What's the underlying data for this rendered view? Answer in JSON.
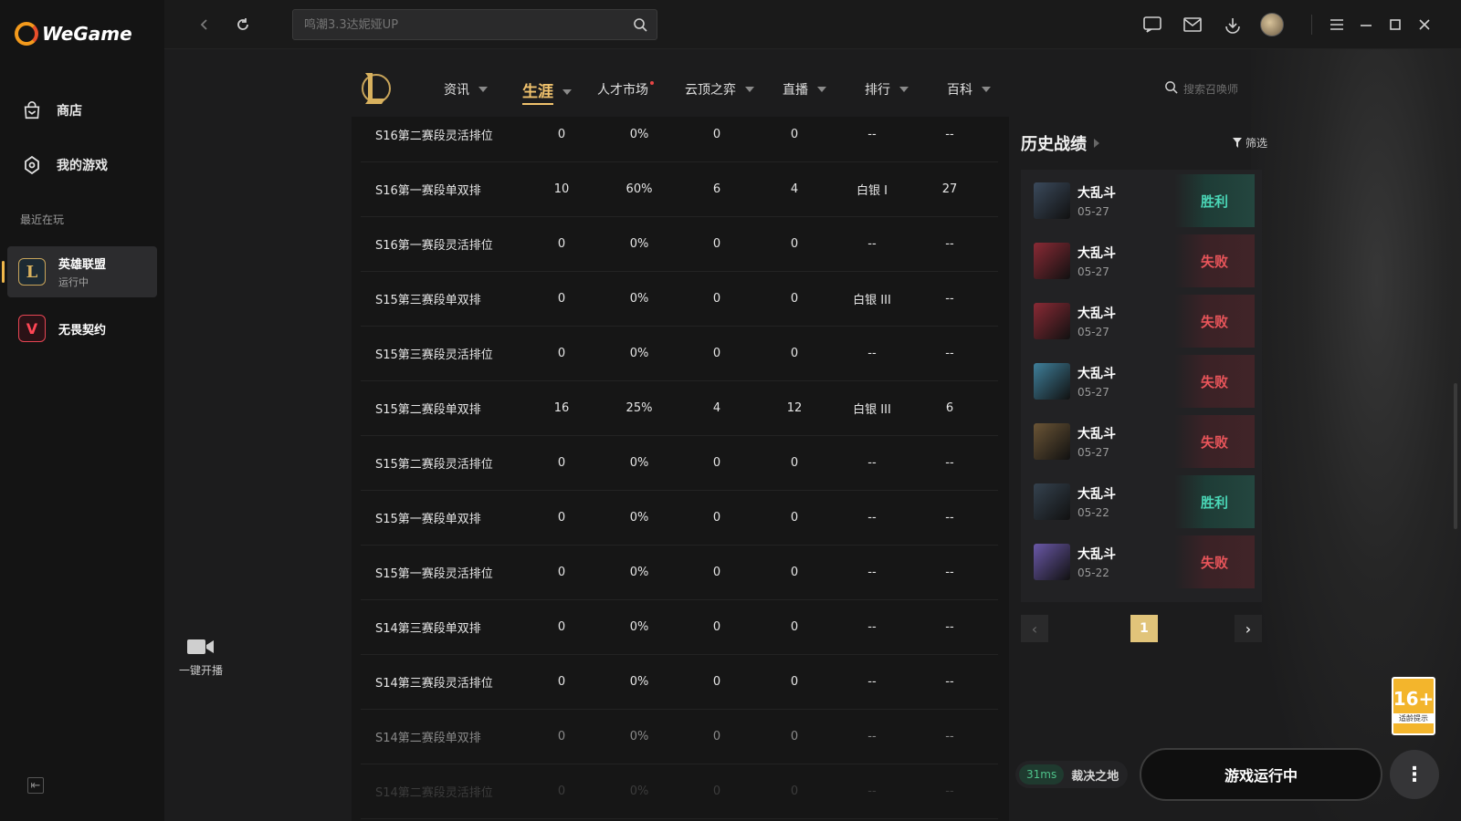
{
  "app": {
    "brand": "WeGame"
  },
  "sidebar": {
    "nav": [
      {
        "label": "商店",
        "icon": "bag-icon"
      },
      {
        "label": "我的游戏",
        "icon": "gamepad-icon"
      }
    ],
    "recent_label": "最近在玩",
    "games": [
      {
        "name": "英雄联盟",
        "status": "运行中",
        "icon": "lol-icon"
      },
      {
        "name": "无畏契约",
        "status": "",
        "icon": "valorant-icon"
      }
    ]
  },
  "topbar": {
    "search_placeholder": "鸣潮3.3达妮娅UP"
  },
  "broadcast": {
    "label": "一键开播"
  },
  "subnav": {
    "items": [
      {
        "label": "资讯",
        "caret": true
      },
      {
        "label": "生涯",
        "caret": true,
        "active": true
      },
      {
        "label": "人才市场",
        "dot": true
      },
      {
        "label": "云顶之弈",
        "caret": true
      },
      {
        "label": "直播",
        "caret": true
      },
      {
        "label": "排行",
        "caret": true
      },
      {
        "label": "百科",
        "caret": true
      }
    ],
    "summoner_search_placeholder": "搜索召唤师"
  },
  "season_table": {
    "rows": [
      [
        "S16第二赛段灵活排位",
        "0",
        "0%",
        "0",
        "0",
        "--",
        "--"
      ],
      [
        "S16第一赛段单双排",
        "10",
        "60%",
        "6",
        "4",
        "白银 I",
        "27"
      ],
      [
        "S16第一赛段灵活排位",
        "0",
        "0%",
        "0",
        "0",
        "--",
        "--"
      ],
      [
        "S15第三赛段单双排",
        "0",
        "0%",
        "0",
        "0",
        "白银 III",
        "--"
      ],
      [
        "S15第三赛段灵活排位",
        "0",
        "0%",
        "0",
        "0",
        "--",
        "--"
      ],
      [
        "S15第二赛段单双排",
        "16",
        "25%",
        "4",
        "12",
        "白银 III",
        "6"
      ],
      [
        "S15第二赛段灵活排位",
        "0",
        "0%",
        "0",
        "0",
        "--",
        "--"
      ],
      [
        "S15第一赛段单双排",
        "0",
        "0%",
        "0",
        "0",
        "--",
        "--"
      ],
      [
        "S15第一赛段灵活排位",
        "0",
        "0%",
        "0",
        "0",
        "--",
        "--"
      ],
      [
        "S14第三赛段单双排",
        "0",
        "0%",
        "0",
        "0",
        "--",
        "--"
      ],
      [
        "S14第三赛段灵活排位",
        "0",
        "0%",
        "0",
        "0",
        "--",
        "--"
      ],
      [
        "S14第二赛段单双排",
        "0",
        "0%",
        "0",
        "0",
        "--",
        "--"
      ],
      [
        "S14第二赛段灵活排位",
        "0",
        "0%",
        "0",
        "0",
        "--",
        "--"
      ]
    ]
  },
  "history": {
    "title": "历史战绩",
    "filter_label": "筛选",
    "matches": [
      {
        "mode": "大乱斗",
        "date": "05-27",
        "result": "胜利",
        "win": true,
        "champ_color": "#3b4a5c"
      },
      {
        "mode": "大乱斗",
        "date": "05-27",
        "result": "失败",
        "win": false,
        "champ_color": "#8a2a35"
      },
      {
        "mode": "大乱斗",
        "date": "05-27",
        "result": "失败",
        "win": false,
        "champ_color": "#8a2a35"
      },
      {
        "mode": "大乱斗",
        "date": "05-27",
        "result": "失败",
        "win": false,
        "champ_color": "#3f7f9a"
      },
      {
        "mode": "大乱斗",
        "date": "05-27",
        "result": "失败",
        "win": false,
        "champ_color": "#6b5536"
      },
      {
        "mode": "大乱斗",
        "date": "05-22",
        "result": "胜利",
        "win": true,
        "champ_color": "#35424f"
      },
      {
        "mode": "大乱斗",
        "date": "05-22",
        "result": "失败",
        "win": false,
        "champ_color": "#6a58a8"
      }
    ],
    "page": "1"
  },
  "status": {
    "ping": "31ms",
    "server": "裁决之地",
    "launch_label": "游戏运行中",
    "age_rating": "16+",
    "age_note": "适龄提示"
  },
  "colors": {
    "accent": "#f0c26d",
    "win": "#4ad6b6",
    "loss": "#e9555a"
  }
}
